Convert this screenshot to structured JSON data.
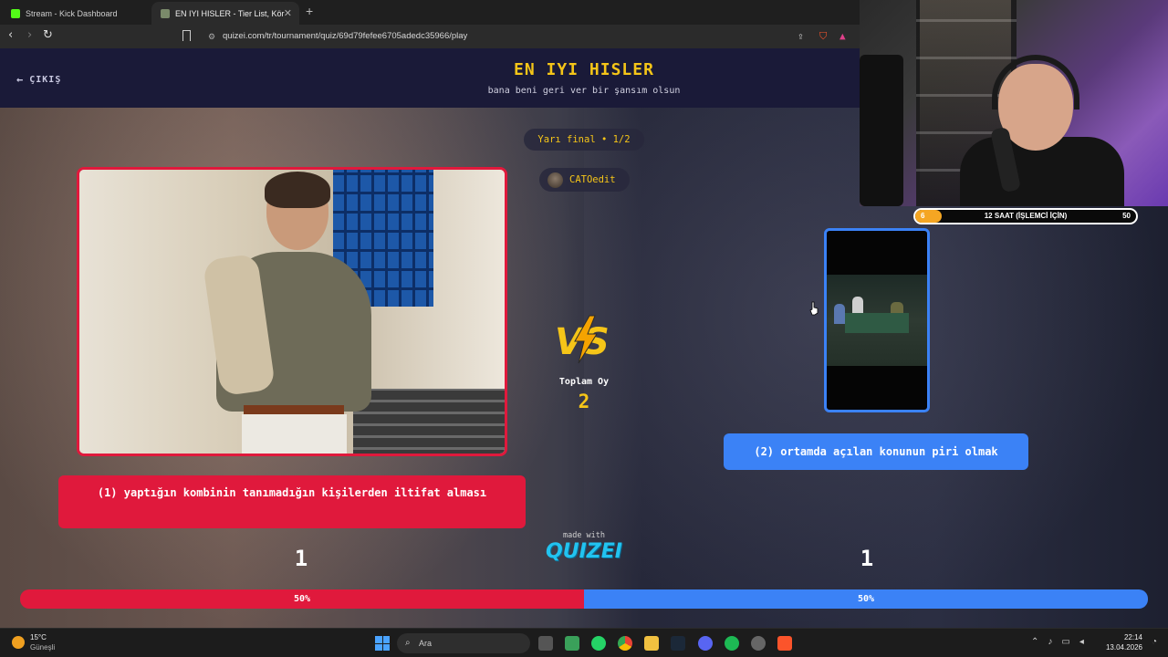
{
  "browser": {
    "tabs": [
      {
        "title": "Stream - Kick Dashboard",
        "favicon_color": "#53fc18"
      },
      {
        "title": "EN IYI HISLER - Tier List, Kör Sıral",
        "favicon_color": "#7a8a6a"
      }
    ],
    "new_tab_label": "+",
    "url": "quizei.com/tr/tournament/quiz/69d79fefee6705adedc35966/play",
    "nav": {
      "back": "‹",
      "forward": "›",
      "reload": "↻"
    }
  },
  "header": {
    "exit_label": "ÇIKIŞ",
    "title": "EN IYI HISLER",
    "subtitle": "bana beni geri ver bir şansım olsun"
  },
  "round": {
    "label": "Yarı final • 1/2",
    "author": "CATOedit"
  },
  "left_option": {
    "caption": "(1) yaptığın kombinin tanımadığın kişilerden iltifat alması",
    "votes": "1",
    "percent_label": "50%",
    "share": 0.5,
    "color": "#e0193c"
  },
  "right_option": {
    "caption": "(2) ortamda açılan konunun piri olmak",
    "votes": "1",
    "percent_label": "50%",
    "share": 0.5,
    "color": "#3b82f6"
  },
  "center": {
    "vs_icon": "vs-lightning-icon",
    "total_label": "Toplam Oy",
    "total_value": "2",
    "made_with": "made with",
    "brand": "QUIZEI"
  },
  "overlay": {
    "timer_label": "12 SAAT (İŞLEMCİ İÇİN)",
    "timer_start": "6",
    "timer_end": "50",
    "timer_progress": 0.12
  },
  "taskbar": {
    "weather_temp": "15°C",
    "weather_desc": "Güneşli",
    "search_placeholder": "Ara",
    "time": "22:14",
    "date": "13.04.2026"
  }
}
